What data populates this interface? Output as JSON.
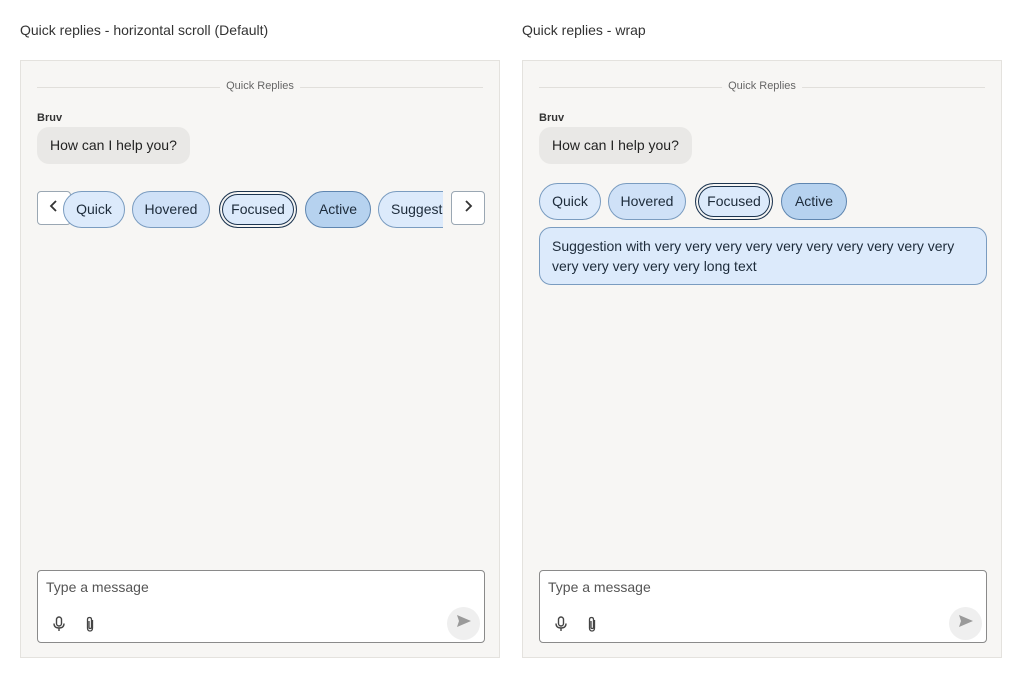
{
  "left": {
    "title": "Quick replies - horizontal scroll (Default)",
    "divider_label": "Quick Replies",
    "sender": "Bruv",
    "message": "How can I help you?",
    "chips": [
      "Quick",
      "Hovered",
      "Focused",
      "Active",
      "Suggestion"
    ],
    "composer_placeholder": "Type a message"
  },
  "right": {
    "title": "Quick replies - wrap",
    "divider_label": "Quick Replies",
    "sender": "Bruv",
    "message": "How can I help you?",
    "chips": [
      "Quick",
      "Hovered",
      "Focused",
      "Active",
      "Suggestion with very very very very very very very very very very very very very very very long text"
    ],
    "composer_placeholder": "Type a message"
  },
  "icons": {
    "prev": "chevron-left-icon",
    "next": "chevron-right-icon",
    "mic": "microphone-icon",
    "attach": "paperclip-icon",
    "send": "send-icon"
  },
  "colors": {
    "chip_fill": "#dceafb",
    "chip_active_fill": "#b6d2ef",
    "panel_bg": "#f7f6f4"
  }
}
